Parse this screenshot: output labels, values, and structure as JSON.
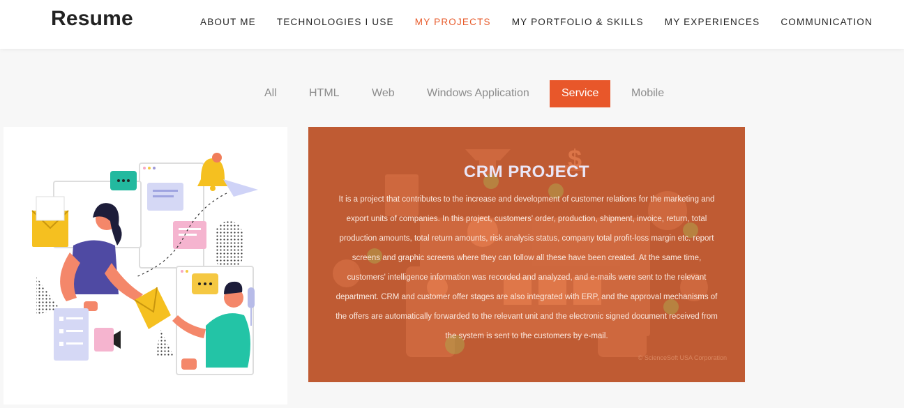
{
  "header": {
    "logo": "Resume",
    "nav": [
      {
        "label": "ABOUT ME",
        "active": false
      },
      {
        "label": "TECHNOLOGIES I USE",
        "active": false
      },
      {
        "label": "MY PROJECTS",
        "active": true
      },
      {
        "label": "MY PORTFOLIO & SKILLS",
        "active": false
      },
      {
        "label": "MY EXPERIENCES",
        "active": false
      },
      {
        "label": "COMMUNICATION",
        "active": false
      }
    ]
  },
  "filters": [
    {
      "label": "All",
      "active": false
    },
    {
      "label": "HTML",
      "active": false
    },
    {
      "label": "Web",
      "active": false
    },
    {
      "label": "Windows Application",
      "active": false
    },
    {
      "label": "Service",
      "active": true
    },
    {
      "label": "Mobile",
      "active": false
    }
  ],
  "projects": {
    "crm": {
      "title": "CRM PROJECT",
      "description": "It is a project that contributes to the increase and development of customer relations for the marketing and export units of companies. In this project, customers' order, production, shipment, invoice, return, total production amounts, total return amounts, risk analysis status, company total profit-loss margin etc. report screens and graphic screens where they can follow all these have been created. At the same time, customers' intelligence information was recorded and analyzed, and e-mails were sent to the relevant department. CRM and customer offer stages are also integrated with ERP, and the approval mechanisms of the offers are automatically forwarded to the relevant unit and the electronic signed document received from the system is sent to the customers by e-mail.",
      "credit": "© ScienceSoft USA Corporation"
    }
  },
  "colors": {
    "accent": "#e8572a",
    "nav_active": "#e75a2a",
    "card_overlay": "#bf5b33"
  }
}
